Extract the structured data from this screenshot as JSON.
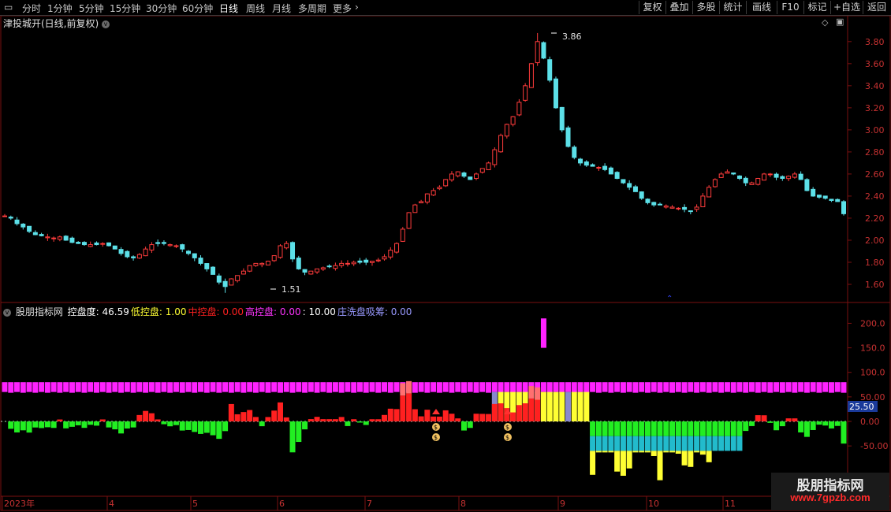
{
  "toolbar": {
    "periods": [
      "分时",
      "1分钟",
      "5分钟",
      "15分钟",
      "30分钟",
      "60分钟",
      "日线",
      "周线",
      "月线",
      "多周期",
      "更多"
    ],
    "active_period": "日线",
    "buttons": [
      "复权",
      "叠加",
      "多股",
      "统计",
      "画线",
      "F10",
      "标记",
      "+自选",
      "返回"
    ]
  },
  "main_header": {
    "title": "津投城开(日线,前复权)"
  },
  "price_axis": [
    "3.80",
    "3.60",
    "3.40",
    "3.20",
    "3.00",
    "2.80",
    "2.60",
    "2.40",
    "2.20",
    "2.00",
    "1.80",
    "1.60"
  ],
  "annotations": {
    "high": "3.86",
    "low": "1.51"
  },
  "indicator": {
    "name": "股朋指标网",
    "items": [
      {
        "label": "控盘度:",
        "value": "46.59",
        "color": "#ffffff"
      },
      {
        "label": "低控盘:",
        "value": "1.00",
        "color": "#ffff33"
      },
      {
        "label": "中控盘:",
        "value": "0.00",
        "color": "#ff2020"
      },
      {
        "label": "高控盘:",
        "value": "0.00",
        "color": "#ff33ff"
      },
      {
        "label": ":",
        "value": "10.00",
        "color": "#ffffff"
      },
      {
        "label": "庄洗盘吸筹:",
        "value": "0.00",
        "color": "#9999ff"
      }
    ],
    "axis": [
      "200.0",
      "150.0",
      "100.0",
      "50.00",
      "0.00",
      "-50.00"
    ],
    "current_value": "25.50"
  },
  "time_axis": [
    "2023年",
    "4",
    "5",
    "6",
    "7",
    "8",
    "9",
    "10",
    "11"
  ],
  "logo": {
    "line1": "股朋指标网",
    "line2": "www.7gpzb.com"
  },
  "chart_data": {
    "type": "candlestick+bar",
    "stock": "津投城开",
    "period": "日线",
    "price_range": [
      1.45,
      3.92
    ],
    "price_high": 3.86,
    "price_low": 1.51,
    "indicator_range": [
      -100,
      220
    ],
    "months": [
      "2023年",
      "4",
      "5",
      "6",
      "7",
      "8",
      "9",
      "10",
      "11"
    ],
    "close_series": [
      2.22,
      2.2,
      2.15,
      2.12,
      2.08,
      2.05,
      2.04,
      2.03,
      2.02,
      2.03,
      2.0,
      1.98,
      1.97,
      1.96,
      1.96,
      1.96,
      1.97,
      1.95,
      1.92,
      1.88,
      1.85,
      1.84,
      1.87,
      1.92,
      1.96,
      1.97,
      1.97,
      1.96,
      1.95,
      1.92,
      1.88,
      1.84,
      1.79,
      1.74,
      1.69,
      1.62,
      1.58,
      1.65,
      1.68,
      1.72,
      1.77,
      1.79,
      1.79,
      1.81,
      1.86,
      1.95,
      1.97,
      1.83,
      1.74,
      1.71,
      1.72,
      1.74,
      1.75,
      1.76,
      1.77,
      1.79,
      1.79,
      1.8,
      1.8,
      1.8,
      1.81,
      1.82,
      1.85,
      1.91,
      1.97,
      2.1,
      2.25,
      2.32,
      2.35,
      2.42,
      2.45,
      2.48,
      2.55,
      2.6,
      2.62,
      2.58,
      2.55,
      2.6,
      2.65,
      2.7,
      2.82,
      2.95,
      3.05,
      3.12,
      3.25,
      3.4,
      3.6,
      3.8,
      3.65,
      3.45,
      3.2,
      3.0,
      2.85,
      2.75,
      2.7,
      2.68,
      2.67,
      2.66,
      2.64,
      2.6,
      2.56,
      2.52,
      2.48,
      2.44,
      2.38,
      2.34,
      2.32,
      2.32,
      2.31,
      2.3,
      2.29,
      2.28,
      2.26,
      2.3,
      2.4,
      2.48,
      2.55,
      2.6,
      2.62,
      2.6,
      2.56,
      2.52,
      2.52,
      2.56,
      2.6,
      2.6,
      2.57,
      2.56,
      2.58,
      2.6,
      2.55,
      2.45,
      2.4,
      2.39,
      2.38,
      2.36,
      2.35,
      2.24
    ]
  }
}
